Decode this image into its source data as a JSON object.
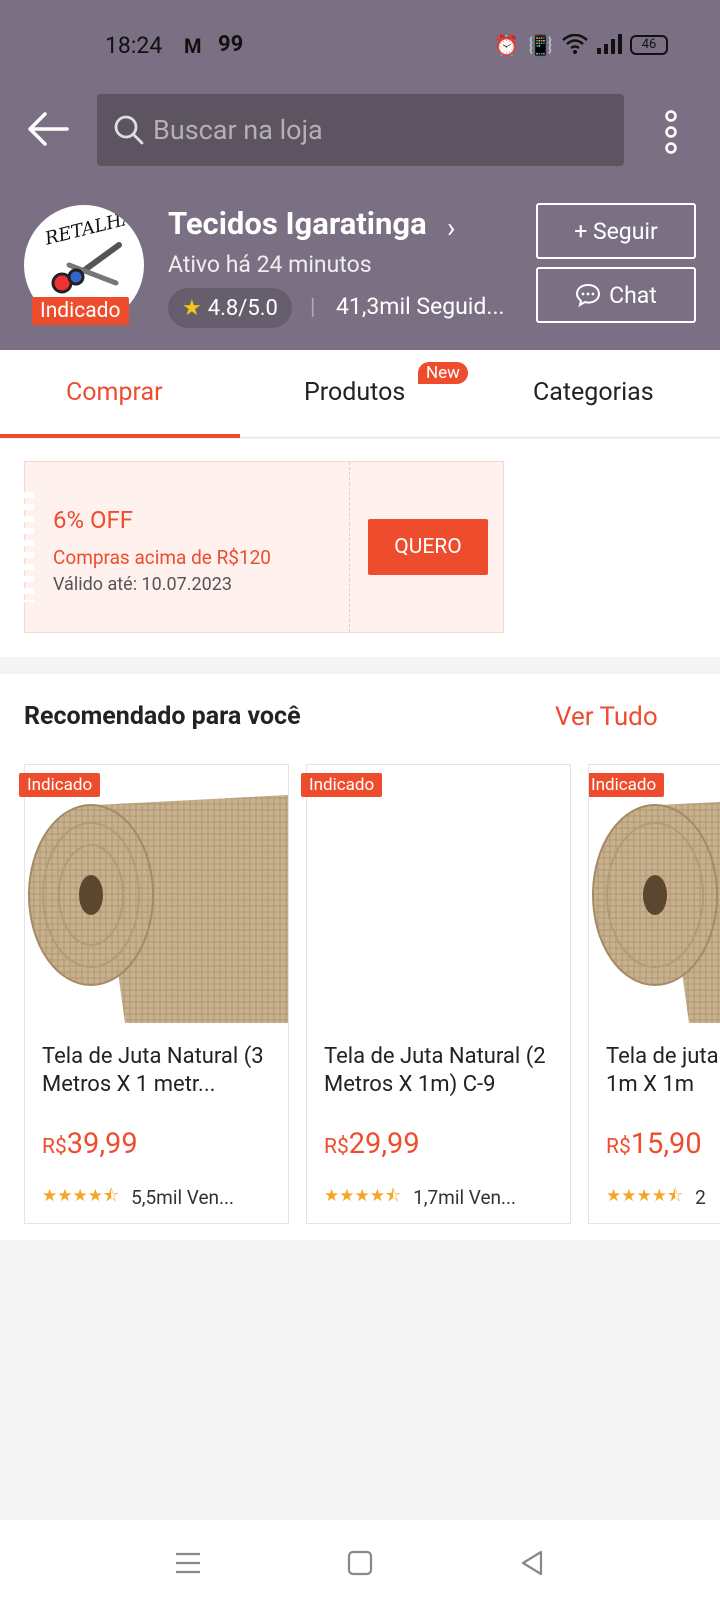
{
  "status_bar": {
    "time": "18:24",
    "notif_icons": [
      "gmail-icon",
      "99-app-icon"
    ],
    "q_label": "99",
    "battery": "46"
  },
  "topbar": {
    "search_placeholder": "Buscar na loja"
  },
  "shop": {
    "name": "Tecidos Igaratinga",
    "status": "Ativo há 24 minutos",
    "rating": "4.8/5.0",
    "followers": "41,3mil Seguid...",
    "badge": "Indicado",
    "logo_text": "RETALHAI",
    "follow_label": "+ Seguir",
    "chat_label": "Chat"
  },
  "tabs": [
    {
      "label": "Comprar",
      "active": true
    },
    {
      "label": "Produtos",
      "badge": "New"
    },
    {
      "label": "Categorias"
    }
  ],
  "voucher": {
    "title": "6% OFF",
    "condition": "Compras acima de R$120",
    "validity": "Válido até: 10.07.2023",
    "cta": "QUERO"
  },
  "recommended": {
    "title": "Recomendado para você",
    "see_all": "Ver Tudo",
    "products": [
      {
        "badge": "Indicado",
        "name": "Tela de Juta Natural (3 Metros X 1 metr...",
        "currency": "R$",
        "price": "39,99",
        "sold": "5,5mil Ven...",
        "rating": 4.5
      },
      {
        "badge": "Indicado",
        "name": "Tela de Juta Natural (2 Metros X 1m) C-9",
        "currency": "R$",
        "price": "29,99",
        "sold": "1,7mil Ven...",
        "rating": 4.5
      },
      {
        "badge": "Indicado",
        "name": "Tela de juta 1m X 1m",
        "currency": "R$",
        "price": "15,90",
        "sold": "2",
        "rating": 4.5
      }
    ]
  },
  "colors": {
    "header": "#7b7083",
    "accent": "#ee4d2d",
    "star": "#f5a623"
  }
}
